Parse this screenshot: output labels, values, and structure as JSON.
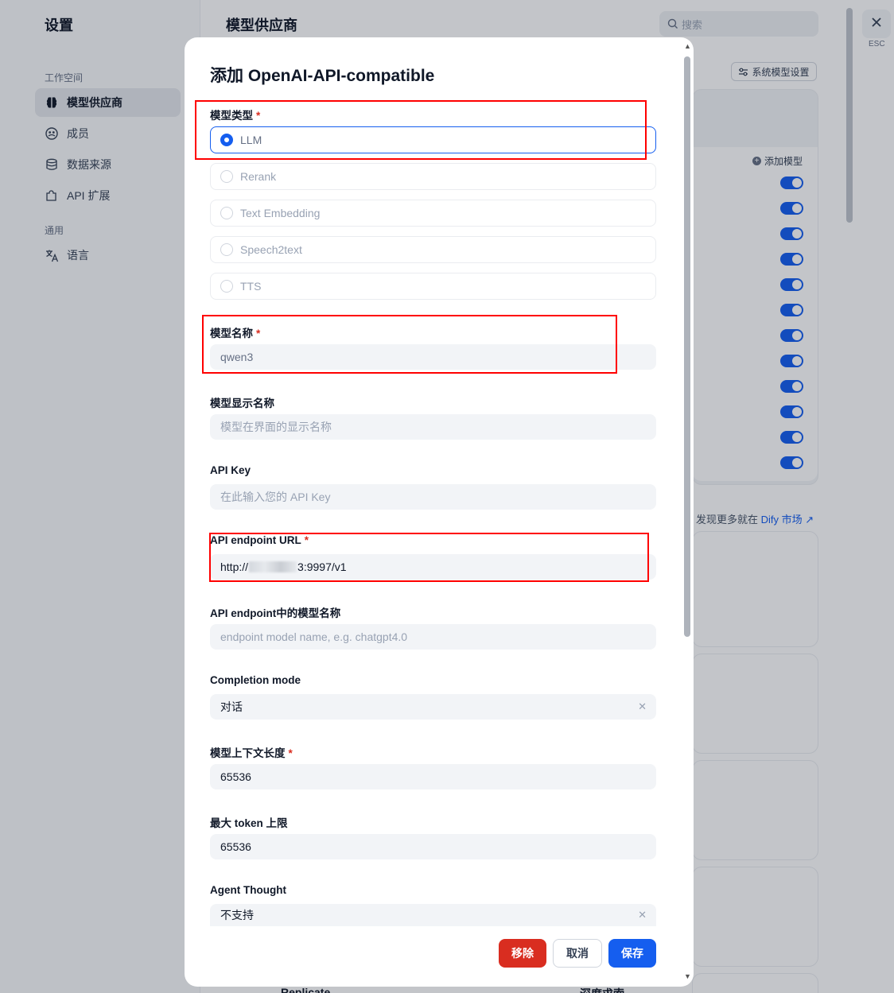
{
  "settings": {
    "title": "设置",
    "workspace_label": "工作空间",
    "general_label": "通用",
    "nav": [
      {
        "label": "模型供应商",
        "icon": "brain-icon"
      },
      {
        "label": "成员",
        "icon": "members-icon"
      },
      {
        "label": "数据来源",
        "icon": "database-icon"
      },
      {
        "label": "API 扩展",
        "icon": "puzzle-icon"
      },
      {
        "label": "语言",
        "icon": "translate-icon"
      }
    ]
  },
  "main": {
    "title": "模型供应商",
    "search_placeholder": "搜索",
    "system_model_settings": "系统模型设置",
    "add_model": "添加模型",
    "discover_prefix": "发现更多就在",
    "discover_link": "Dify 市场",
    "bottom_left": "Replicate",
    "bottom_right": "深度求索",
    "esc_label": "ESC"
  },
  "modal": {
    "title": "添加 OpenAI-API-compatible",
    "model_type_label": "模型类型",
    "model_types": [
      "LLM",
      "Rerank",
      "Text Embedding",
      "Speech2text",
      "TTS"
    ],
    "selected_model_type": "LLM",
    "model_name_label": "模型名称",
    "model_name_value": "qwen3",
    "display_name_label": "模型显示名称",
    "display_name_placeholder": "模型在界面的显示名称",
    "api_key_label": "API Key",
    "api_key_placeholder": "在此输入您的 API Key",
    "endpoint_url_label": "API endpoint URL",
    "endpoint_url_prefix": "http://",
    "endpoint_url_suffix": "3:9997/v1",
    "endpoint_model_label": "API endpoint中的模型名称",
    "endpoint_model_placeholder": "endpoint model name, e.g. chatgpt4.0",
    "completion_mode_label": "Completion mode",
    "completion_mode_value": "对话",
    "context_length_label": "模型上下文长度",
    "context_length_value": "65536",
    "max_token_label": "最大 token 上限",
    "max_token_value": "65536",
    "agent_thought_label": "Agent Thought",
    "agent_thought_value": "不支持",
    "remove_button": "移除",
    "cancel_button": "取消",
    "save_button": "保存"
  },
  "colors": {
    "primary": "#155eef",
    "danger": "#d92d20",
    "highlight_box": "#ff0000"
  }
}
